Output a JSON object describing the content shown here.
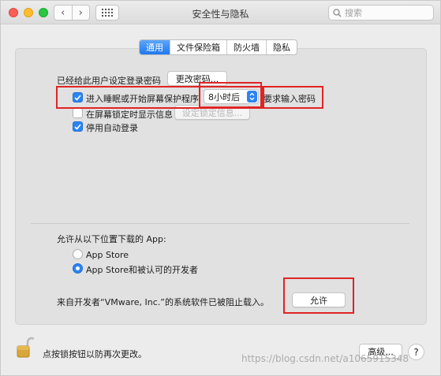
{
  "window": {
    "title": "安全性与隐私",
    "search_placeholder": "搜索",
    "nav_back": "‹",
    "nav_forward": "›"
  },
  "tabs": [
    {
      "label": "通用",
      "active": true
    },
    {
      "label": "文件保险箱",
      "active": false
    },
    {
      "label": "防火墙",
      "active": false
    },
    {
      "label": "隐私",
      "active": false
    }
  ],
  "general": {
    "password_set_label": "已经给此用户设定登录密码",
    "change_password_button": "更改密码...",
    "require_password": {
      "checked": true,
      "label": "进入睡眠或开始屏幕保护程序",
      "selected_delay": "8小时后",
      "suffix": "要求输入密码"
    },
    "show_message": {
      "checked": false,
      "label": "在屏幕锁定时显示信息",
      "button": "设定锁定信息..."
    },
    "disable_auto_login": {
      "checked": true,
      "label": "停用自动登录"
    }
  },
  "downloads": {
    "heading": "允许从以下位置下载的 App:",
    "options": [
      {
        "label": "App Store",
        "selected": false
      },
      {
        "label": "App Store和被认可的开发者",
        "selected": true
      }
    ],
    "blocked_message": "来自开发者“VMware, Inc.”的系统软件已被阻止载入。",
    "allow_button": "允许"
  },
  "footer": {
    "lock_message": "点按锁按钮以防再次更改。",
    "advanced_button": "高级...",
    "help_button": "?"
  },
  "watermark": "https://blog.csdn.net/a1065915348",
  "colors": {
    "accent": "#2c84f3",
    "highlight_box": "#e02424"
  }
}
